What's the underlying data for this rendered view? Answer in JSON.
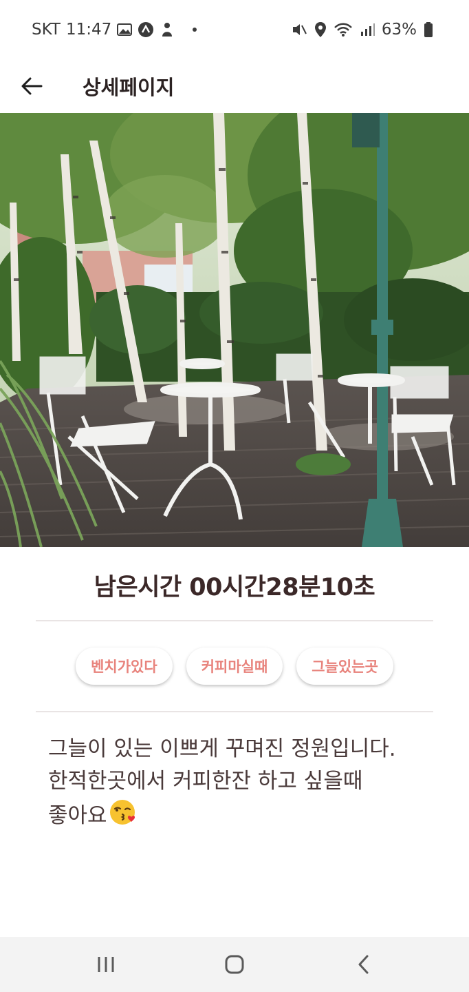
{
  "status_bar": {
    "carrier": "SKT",
    "time": "11:47",
    "battery": "63%",
    "icons_left": [
      "image-icon",
      "app-icon",
      "person-icon"
    ],
    "icons_right": [
      "mute-icon",
      "location-icon",
      "wifi-icon",
      "signal-icon",
      "battery-icon"
    ]
  },
  "app_bar": {
    "title": "상세페이지",
    "back_icon": "arrow-left-icon"
  },
  "detail": {
    "timer": "남은시간 00시간28분10초",
    "tags": [
      "벤치가있다",
      "커피마실때",
      "그늘있는곳"
    ],
    "description_line1": "그늘이 있는 이쁘게 꾸며진 정원입니다.",
    "description_line2": "한적한곳에서 커피한잔 하고 싶을때",
    "description_line3": "좋아요",
    "emoji": "kissing-face-emoji"
  },
  "nav_bar": {
    "buttons": [
      "recents-icon",
      "home-icon",
      "back-icon"
    ]
  },
  "colors": {
    "accent": "#e8837c",
    "title": "#2b2222",
    "nav_bg": "#f3f3f3"
  }
}
